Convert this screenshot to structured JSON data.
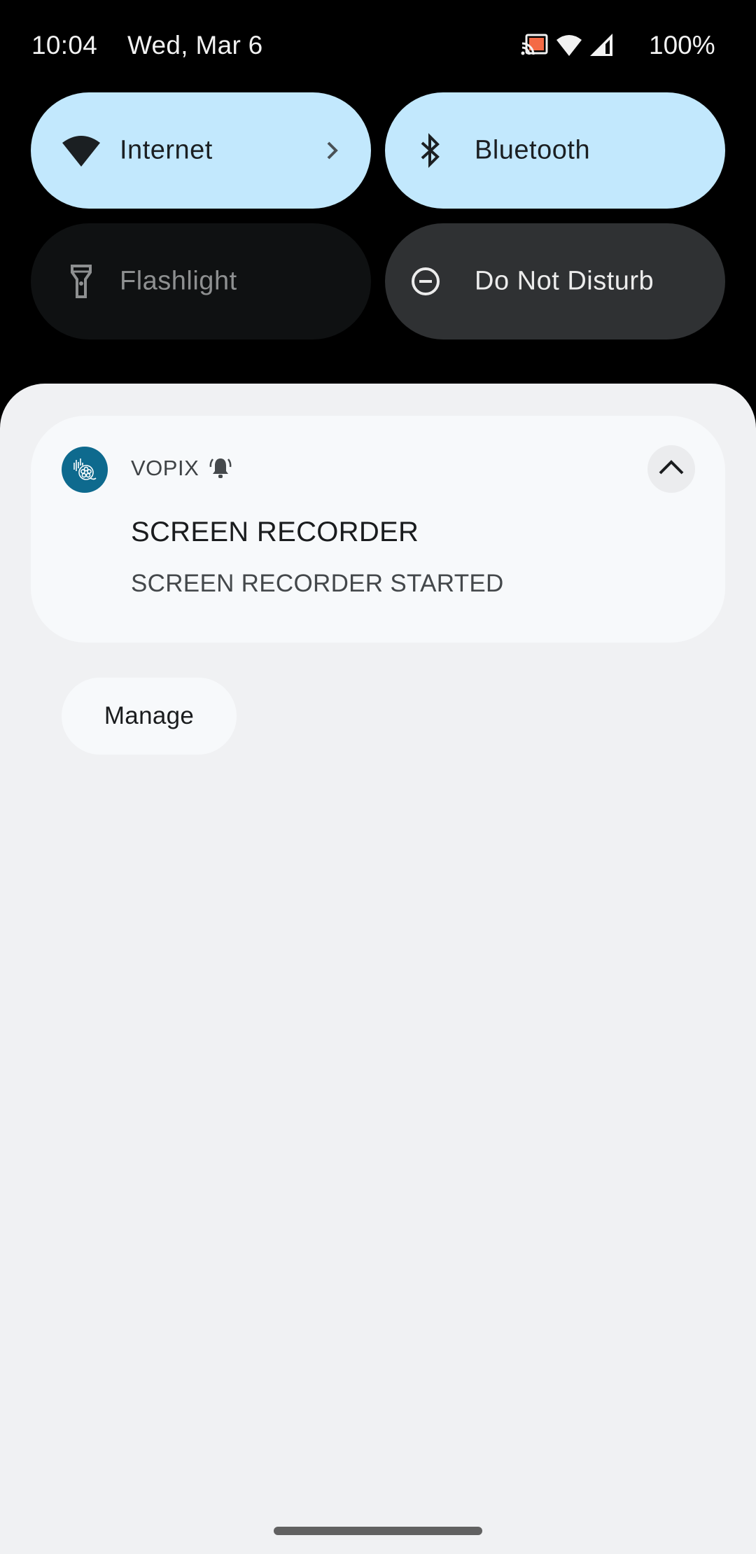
{
  "status_bar": {
    "time": "10:04",
    "date": "Wed, Mar 6",
    "battery": "100%",
    "icons": [
      "cast-icon",
      "wifi-icon",
      "cellular-signal-icon"
    ],
    "cast_accent": "#f46a45"
  },
  "quick_settings": {
    "tiles": [
      {
        "label": "Internet",
        "icon": "wifi-icon",
        "state": "on",
        "has_chevron": true
      },
      {
        "label": "Bluetooth",
        "icon": "bluetooth-icon",
        "state": "on"
      },
      {
        "label": "Flashlight",
        "icon": "flashlight-icon",
        "state": "unavailable"
      },
      {
        "label": "Do Not Disturb",
        "icon": "do-not-disturb-icon",
        "state": "off"
      }
    ],
    "active_color": "#c2e8fd"
  },
  "notification": {
    "app_name": "VOPIX",
    "app_icon": "film-reel-icon",
    "app_icon_color": "#0e6a8e",
    "alert_icon": "bell-ringing-icon",
    "title": "SCREEN RECORDER",
    "text": "SCREEN RECORDER STARTED",
    "expand_icon": "chevron-up-icon"
  },
  "actions": {
    "manage_label": "Manage"
  }
}
